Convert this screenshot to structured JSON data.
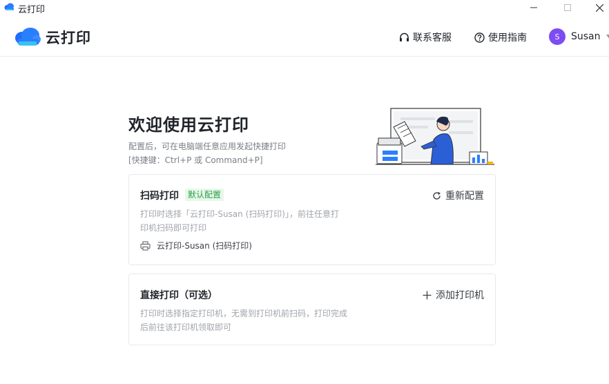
{
  "window": {
    "title": "云打印",
    "controls": {
      "minimize": "—",
      "maximize": "☐",
      "close": "✕"
    }
  },
  "header": {
    "brand": "云打印",
    "nav": {
      "support": {
        "label": "联系客服",
        "icon": "headset-icon"
      },
      "guide": {
        "label": "使用指南",
        "icon": "help-circle-icon"
      }
    },
    "user": {
      "avatar_initial": "S",
      "name": "Susan"
    }
  },
  "welcome": {
    "title": "欢迎使用云打印",
    "subtitle_line1": "配置后，可在电脑端任意应用发起快捷打印",
    "subtitle_line2": "[快捷键：Ctrl+P 或 Command+P]"
  },
  "cards": {
    "scan": {
      "title": "扫码打印",
      "badge": "默认配置",
      "action": "重新配置",
      "desc_line1": "打印时选择「云打印-Susan (扫码打印)」，前往任意打",
      "desc_line2": "印机扫码即可打印",
      "printer_name": "云打印-Susan (扫码打印)"
    },
    "direct": {
      "title": "直接打印（可选）",
      "action": "添加打印机",
      "desc_line1": "打印时选择指定打印机，无需到打印机前扫码，打印完成",
      "desc_line2": "后前往该打印机领取即可"
    }
  },
  "colors": {
    "brand_blue": "#2a7fff",
    "avatar_purple": "#7d4cf2",
    "badge_green": "#27a046",
    "badge_bg": "#e8f7ea"
  }
}
